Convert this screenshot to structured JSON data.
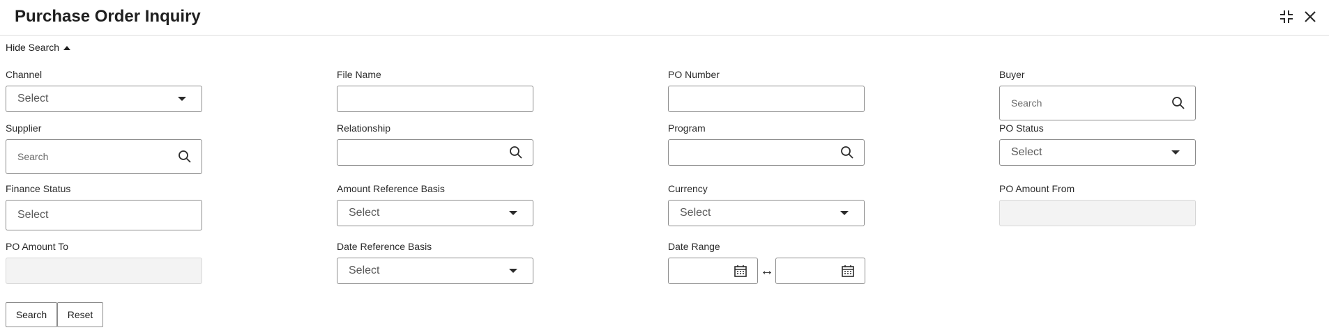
{
  "header": {
    "title": "Purchase Order Inquiry",
    "icons": [
      "collapse-icon",
      "close-icon"
    ]
  },
  "search_toggle": {
    "label": "Hide Search"
  },
  "fields": {
    "channel": {
      "label": "Channel",
      "value": "Select"
    },
    "file_name": {
      "label": "File Name",
      "value": ""
    },
    "po_number": {
      "label": "PO Number",
      "value": ""
    },
    "buyer": {
      "label": "Buyer",
      "placeholder": "Search"
    },
    "supplier": {
      "label": "Supplier",
      "placeholder": "Search"
    },
    "relationship": {
      "label": "Relationship",
      "value": ""
    },
    "program": {
      "label": "Program",
      "value": ""
    },
    "po_status": {
      "label": "PO Status",
      "value": "Select"
    },
    "finance_status": {
      "label": "Finance Status",
      "value": "Select"
    },
    "amount_reference_basis": {
      "label": "Amount Reference Basis",
      "value": "Select"
    },
    "currency": {
      "label": "Currency",
      "value": "Select"
    },
    "po_amount_from": {
      "label": "PO Amount From",
      "value": ""
    },
    "po_amount_to": {
      "label": "PO Amount To",
      "value": ""
    },
    "date_reference_basis": {
      "label": "Date Reference Basis",
      "value": "Select"
    },
    "date_range": {
      "label": "Date Range",
      "separator": "↔"
    }
  },
  "buttons": {
    "search": "Search",
    "reset": "Reset"
  }
}
